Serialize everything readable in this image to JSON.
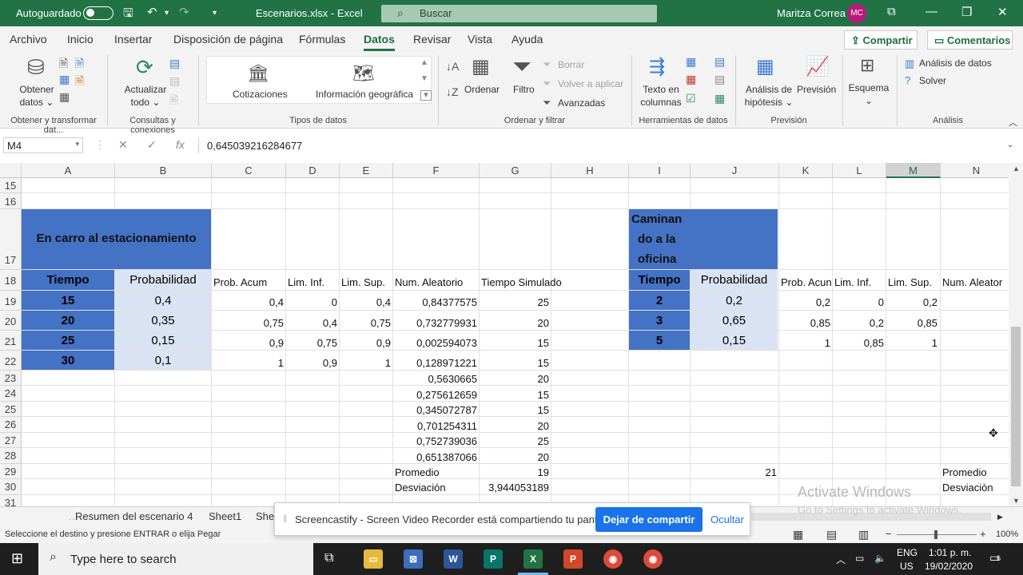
{
  "titlebar": {
    "autosave": "Autoguardado",
    "title": "Escenarios.xlsx  -  Excel",
    "search": "Buscar",
    "user": "Maritza Correa",
    "initials": "MC"
  },
  "menu": {
    "tabs": [
      "Archivo",
      "Inicio",
      "Insertar",
      "Disposición de página",
      "Fórmulas",
      "Datos",
      "Revisar",
      "Vista",
      "Ayuda"
    ],
    "share": "Compartir",
    "comments": "Comentarios"
  },
  "ribbon": {
    "obtener1": "Obtener",
    "obtener2": "datos ⌄",
    "actualizar1": "Actualizar",
    "actualizar2": "todo ⌄",
    "g1": "Obtener y transformar dat...",
    "g2": "Consultas y conexiones",
    "cotizaciones": "Cotizaciones",
    "geografica": "Información geográfica",
    "g3": "Tipos de datos",
    "ordenar": "Ordenar",
    "filtro": "Filtro",
    "borrar": "Borrar",
    "volver": "Volver a aplicar",
    "avanzadas": "Avanzadas",
    "g4": "Ordenar y filtrar",
    "texto1": "Texto en",
    "texto2": "columnas",
    "g5": "Herramientas de datos",
    "analisis1": "Análisis de",
    "analisis2": "hipótesis ⌄",
    "prevision": "Previsión",
    "g6": "Previsión",
    "esquema": "Esquema",
    "analisis_datos": "Análisis de datos",
    "solver": "Solver",
    "g7": "Análisis"
  },
  "formula_bar": {
    "namebox": "M4",
    "value": "0,645039216284677"
  },
  "sheet": {
    "columns": [
      "A",
      "B",
      "C",
      "D",
      "E",
      "F",
      "G",
      "H",
      "I",
      "J",
      "K",
      "L",
      "M",
      "N"
    ],
    "rows": [
      "15",
      "16",
      "17",
      "18",
      "19",
      "20",
      "21",
      "22",
      "23",
      "24",
      "25",
      "26",
      "27",
      "28",
      "29",
      "30",
      "31"
    ],
    "left_title": "En carro al estacionamiento",
    "right_title1": "Caminan",
    "right_title2": "do a la",
    "right_title3": "oficina",
    "hdr_tiempo": "Tiempo",
    "hdr_prob": "Probabilidad",
    "hdr_acum": "Prob. Acum",
    "hdr_inf": "Lim. Inf.",
    "hdr_sup": "Lim. Sup.",
    "hdr_aleat": "Num. Aleatorio",
    "hdr_sim": "Tiempo Simulado",
    "hdr_acum_r": "Prob. Acun",
    "hdr_aleat_r": "Num. Aleator",
    "left_table": [
      {
        "t": "15",
        "p": "0,4",
        "acum": "0,4",
        "inf": "0",
        "sup": "0,4",
        "rand": "0,84377575",
        "sim": "25"
      },
      {
        "t": "20",
        "p": "0,35",
        "acum": "0,75",
        "inf": "0,4",
        "sup": "0,75",
        "rand": "0,732779931",
        "sim": "20"
      },
      {
        "t": "25",
        "p": "0,15",
        "acum": "0,9",
        "inf": "0,75",
        "sup": "0,9",
        "rand": "0,002594073",
        "sim": "15"
      },
      {
        "t": "30",
        "p": "0,1",
        "acum": "1",
        "inf": "0,9",
        "sup": "1",
        "rand": "0,128971221",
        "sim": "15"
      }
    ],
    "extra_rand": [
      {
        "rand": "0,5630665",
        "sim": "20"
      },
      {
        "rand": "0,275612659",
        "sim": "15"
      },
      {
        "rand": "0,345072787",
        "sim": "15"
      },
      {
        "rand": "0,701254311",
        "sim": "20"
      },
      {
        "rand": "0,752739036",
        "sim": "25"
      },
      {
        "rand": "0,651387066",
        "sim": "20"
      }
    ],
    "promedio": "Promedio",
    "promedio_val": "19",
    "desviacion": "Desviación",
    "desviacion_val": "3,944053189",
    "right_val21": "21",
    "promedio_r": "Promedio",
    "desviacion_r": "Desviaciòn",
    "right_table": [
      {
        "t": "2",
        "p": "0,2",
        "acum": "0,2",
        "inf": "0",
        "sup": "0,2"
      },
      {
        "t": "3",
        "p": "0,65",
        "acum": "0,85",
        "inf": "0,2",
        "sup": "0,85"
      },
      {
        "t": "5",
        "p": "0,15",
        "acum": "1",
        "inf": "0,85",
        "sup": "1"
      }
    ]
  },
  "tabs_bottom": [
    "Resumen del escenario 4",
    "Sheet1",
    "She"
  ],
  "status": "Seleccione el destino y presione ENTRAR o elija Pegar",
  "zoom": "100%",
  "toast": {
    "message": "Screencastify - Screen Video Recorder está compartiendo tu pantalla.",
    "stop": "Dejar de compartir",
    "hide": "Ocultar"
  },
  "watermark": {
    "line1": "Activate Windows",
    "line2": "Go to Settings to activate Windows."
  },
  "taskbar": {
    "search": "Type here to search",
    "lang1": "ENG",
    "lang2": "US",
    "time": "1:01 p. m.",
    "date": "19/02/2020",
    "notif": "6"
  },
  "colors": {
    "excel_green": "#217346",
    "header_blue": "#4472c4",
    "light_blue": "#dae3f3"
  }
}
